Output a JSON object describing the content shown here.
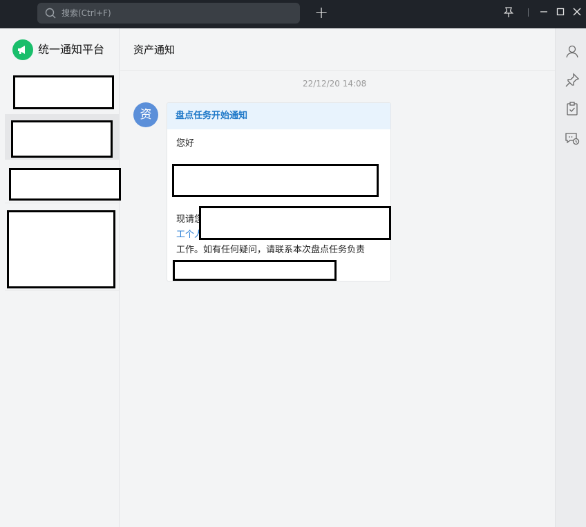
{
  "titlebar": {
    "search_placeholder": "搜索(Ctrl+F)",
    "add_symbol": "+"
  },
  "sidebar": {
    "app_name": "统一通知平台"
  },
  "chat": {
    "title": "资产通知",
    "timestamp": "22/12/20 14:08",
    "sender_avatar_text": "资",
    "message": {
      "title": "盘点任务开始通知",
      "greeting": "您好",
      "line_now_prefix": "现请您",
      "line_link_prefix": "工个人",
      "line_work": "工作。如有任何疑问，请联系本次盘点任务负责"
    }
  },
  "colors": {
    "titlebar_bg": "#1f2329",
    "brand_green": "#19be6b",
    "avatar_blue": "#5b8fd9",
    "card_title": "#1e78c8",
    "link": "#2b7fd6"
  }
}
